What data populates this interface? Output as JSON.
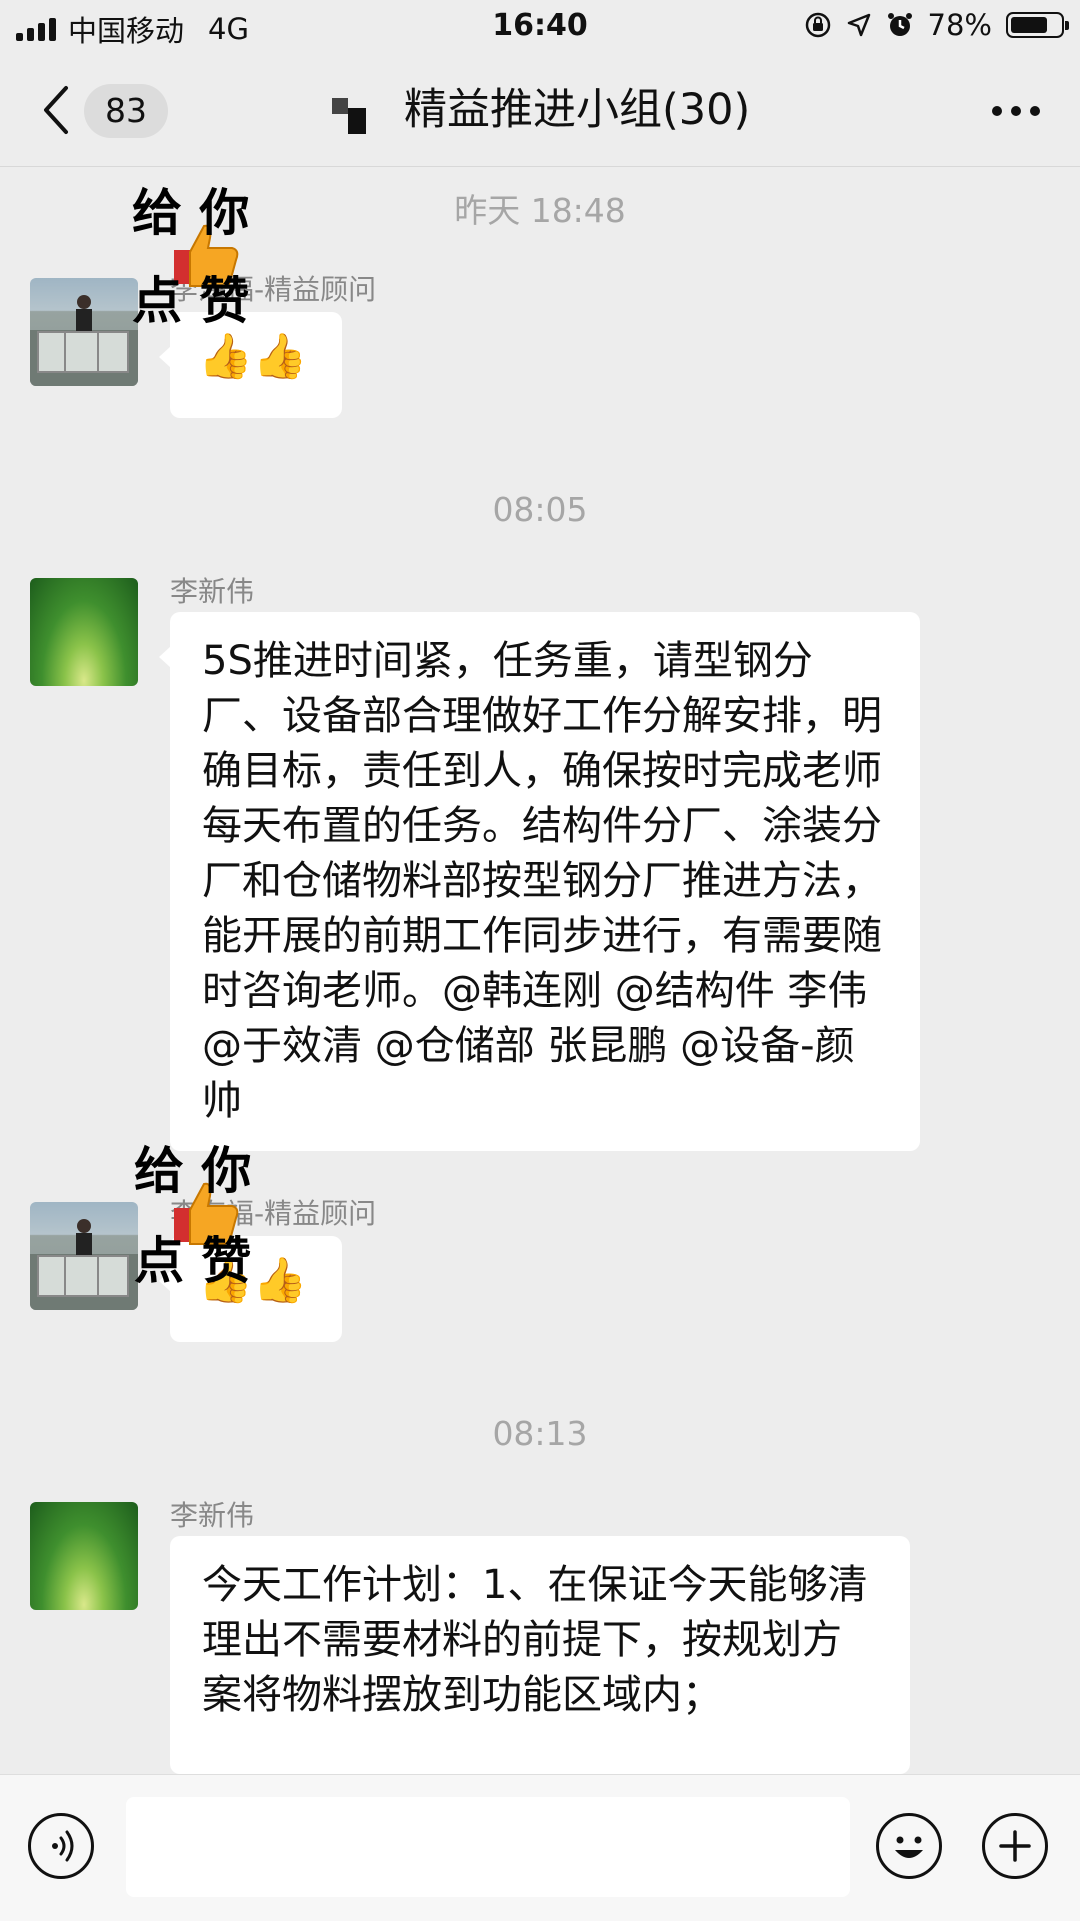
{
  "status_bar": {
    "carrier": "中国移动",
    "network": "4G",
    "time": "16:40",
    "battery": "78%",
    "battery_level": 0.78
  },
  "header": {
    "unread_count": "83",
    "title": "精益推进小组(30)"
  },
  "messages": [
    {
      "timestamp": "昨天 18:48",
      "sender": "李海福-精益顾问",
      "type": "emoji",
      "content": "👍👍",
      "sticker_text": "给你点赞"
    },
    {
      "timestamp": "08:05",
      "sender": "李新伟",
      "type": "text",
      "content": "5S推进时间紧，任务重，请型钢分厂、设备部合理做好工作分解安排，明确目标，责任到人，确保按时完成老师每天布置的任务。结构件分厂、涂装分厂和仓储物料部按型钢分厂推进方法，能开展的前期工作同步进行，有需要随时咨询老师。@韩连刚 @结构件 李伟 @于效清 @仓储部 张昆鹏 @设备-颜帅"
    },
    {
      "sender": "李海福-精益顾问",
      "type": "emoji",
      "content": "👍👍",
      "sticker_text": "给你点赞"
    },
    {
      "timestamp": "08:13",
      "sender": "李新伟",
      "type": "text",
      "content": "今天工作计划：1、在保证今天能够清理出不需要材料的前提下，按规划方案将物料摆放到功能区域内；"
    }
  ],
  "input": {
    "value": "",
    "placeholder": ""
  },
  "icons": {
    "back": "chevron-left-icon",
    "more": "more-dots-icon",
    "voice": "voice-icon",
    "emoji": "emoji-icon",
    "plus": "plus-icon",
    "thumbs_up": "thumbs-up-icon"
  }
}
